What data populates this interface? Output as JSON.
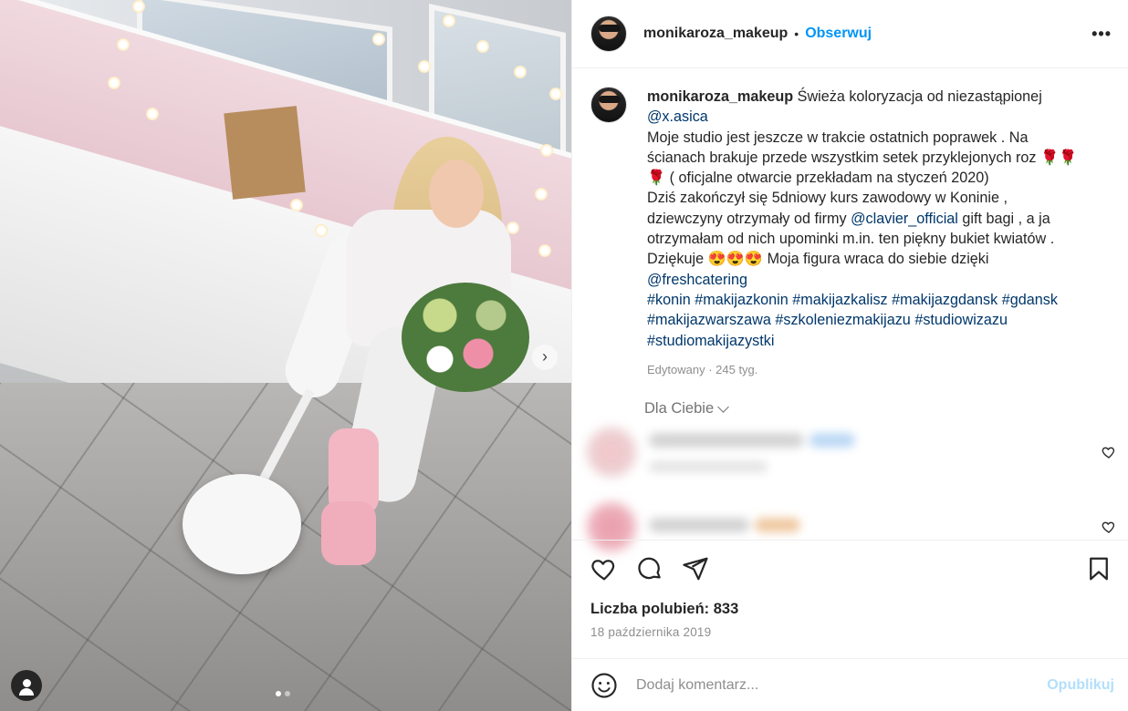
{
  "post": {
    "username": "monikaroza_makeup",
    "separator": "•",
    "follow_label": "Obserwuj",
    "more_label": "•••",
    "caption": {
      "username": "monikaroza_makeup",
      "l1": "Świeża koloryzacja od niezastąpionej",
      "mention1": "@x.asica",
      "l2": "Moje studio jest jeszcze w trakcie ostatnich poprawek . Na",
      "l3": "ścianach brakuje przede wszystkim setek przyklejonych roz",
      "rose": "🌹",
      "l4": "( oficjalne otwarcie przekładam na styczeń 2020)",
      "l5": "Dziś zakończył się 5dniowy kurs zawodowy w Koninie ,",
      "l6a": "dziewczyny otrzymały od firmy",
      "mention2": "@clavier_official",
      "l6b": "gift bagi , a ja",
      "l7": "otrzymałam od nich upominki m.in. ten piękny bukiet kwiatów .",
      "l8a": "Dziękuje",
      "heart_eyes": "😍",
      "l8b": "Moja figura wraca do siebie dzięki",
      "mention3": "@freshcatering",
      "hashtags": [
        "#konin",
        "#makijazkonin",
        "#makijazkalisz",
        "#makijazgdansk",
        "#gdansk",
        "#makijazwarszawa",
        "#szkoleniezmakijazu",
        "#studiowizazu",
        "#studiomakijazystki"
      ],
      "meta": "Edytowany · 245 tyg."
    },
    "for_you_label": "Dla Ciebie",
    "likes_text": "Liczba polubień: 833",
    "date": "18 października 2019",
    "comment_placeholder": "Dodaj komentarz...",
    "publish_label": "Opublikuj",
    "carousel": {
      "total": 2,
      "active": 1
    }
  },
  "colors": {
    "accent": "#0095f6",
    "mention": "#00376b",
    "muted": "#8e8e8e",
    "publish_disabled": "#b2dffc"
  },
  "icons": [
    "more-icon",
    "chevron-down-icon",
    "heart-icon",
    "comment-icon",
    "share-icon",
    "bookmark-icon",
    "emoji-icon",
    "user-tag-icon",
    "carousel-next-icon"
  ]
}
